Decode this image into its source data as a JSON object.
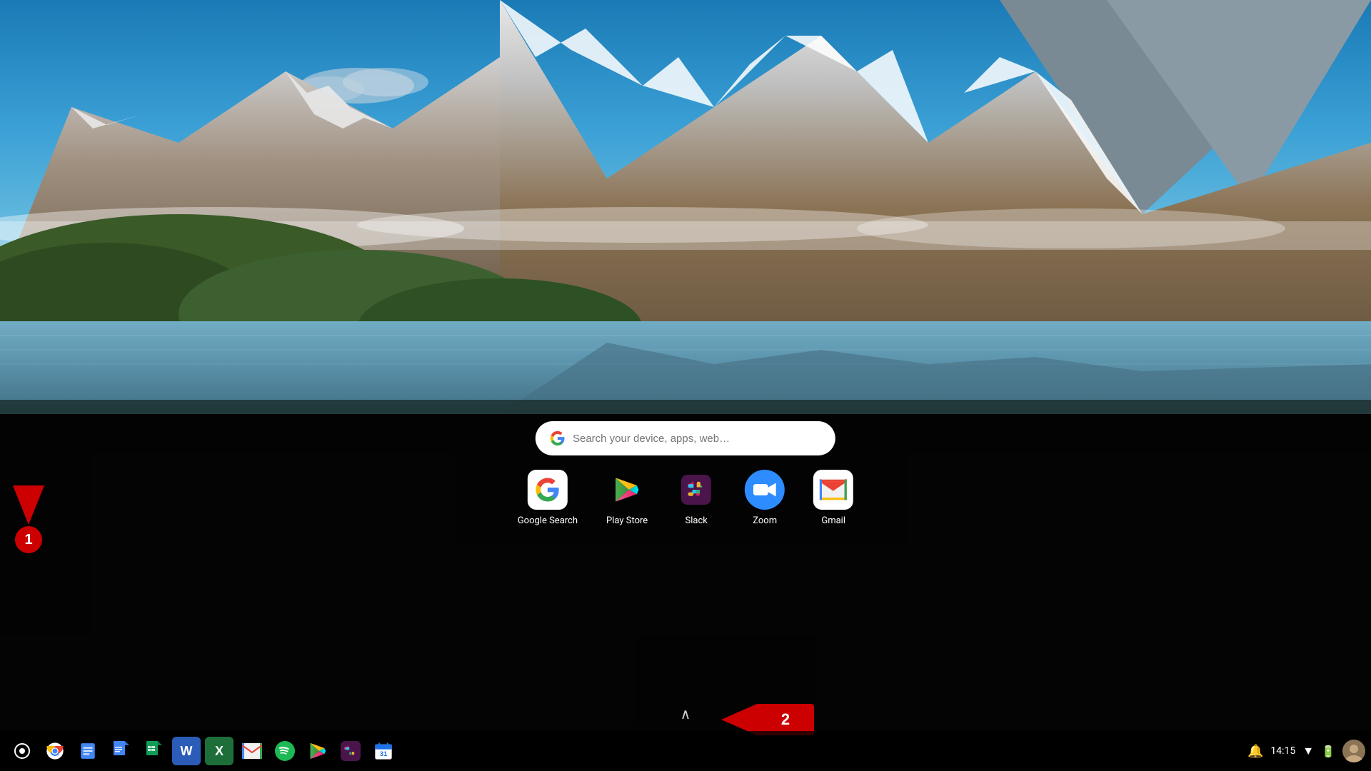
{
  "wallpaper": {
    "alt": "Mountain lake landscape wallpaper"
  },
  "searchBar": {
    "placeholder": "Search your device, apps, web…"
  },
  "appIcons": [
    {
      "id": "google-search",
      "label": "Google Search",
      "icon": "G",
      "bgColor": "#ffffff",
      "iconColor": "#4285F4"
    },
    {
      "id": "play-store",
      "label": "Play Store",
      "icon": "▶",
      "bgColor": "transparent",
      "iconColor": "#00A976"
    },
    {
      "id": "slack",
      "label": "Slack",
      "icon": "S",
      "bgColor": "#4A154B",
      "iconColor": "#ffffff"
    },
    {
      "id": "zoom",
      "label": "Zoom",
      "icon": "📷",
      "bgColor": "#2D8CFF",
      "iconColor": "#ffffff"
    },
    {
      "id": "gmail",
      "label": "Gmail",
      "icon": "M",
      "bgColor": "#ffffff",
      "iconColor": "#EA4335"
    }
  ],
  "taskbarIcons": [
    {
      "id": "launcher",
      "icon": "⊙",
      "color": "#ffffff"
    },
    {
      "id": "chrome",
      "icon": "🌐",
      "color": "#ffffff"
    },
    {
      "id": "files",
      "icon": "📁",
      "color": "#4285F4"
    },
    {
      "id": "docs",
      "icon": "📄",
      "color": "#4285F4"
    },
    {
      "id": "sheets",
      "icon": "📊",
      "color": "#0F9D58"
    },
    {
      "id": "word",
      "icon": "W",
      "color": "#2B5CB8"
    },
    {
      "id": "excel",
      "icon": "X",
      "color": "#1E6E3A"
    },
    {
      "id": "gmail-tb",
      "icon": "M",
      "color": "#EA4335"
    },
    {
      "id": "spotify",
      "icon": "♫",
      "color": "#1DB954"
    },
    {
      "id": "play-store-tb",
      "icon": "▶",
      "color": "#00A976"
    },
    {
      "id": "slack-tb",
      "icon": "S",
      "color": "#4A154B"
    },
    {
      "id": "calendar",
      "icon": "31",
      "color": "#1A73E8"
    }
  ],
  "systemTray": {
    "time": "14:15",
    "notificationIcon": "🔔"
  },
  "annotations": {
    "arrow1": {
      "number": "1",
      "direction": "down"
    },
    "arrow2": {
      "number": "2",
      "direction": "left"
    }
  },
  "chevronUp": "∧"
}
